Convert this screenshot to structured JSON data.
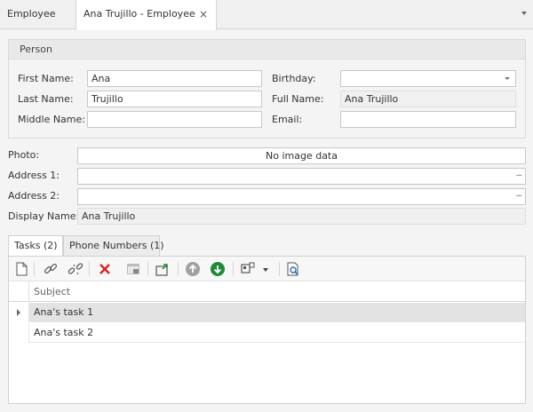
{
  "doc_tabs": {
    "first": "Employee",
    "active": "Ana Trujillo - Employee",
    "close": "×"
  },
  "person": {
    "header": "Person",
    "first_name_label": "First Name:",
    "first_name": "Ana",
    "last_name_label": "Last Name:",
    "last_name": "Trujillo",
    "middle_name_label": "Middle Name:",
    "middle_name": "",
    "birthday_label": "Birthday:",
    "birthday": "",
    "full_name_label": "Full Name:",
    "full_name": "Ana Trujillo",
    "email_label": "Email:",
    "email": ""
  },
  "details": {
    "photo_label": "Photo:",
    "photo_value": "No image data",
    "address1_label": "Address 1:",
    "address1": "",
    "address2_label": "Address 2:",
    "address2": "",
    "display_name_label": "Display Name:",
    "display_name": "Ana Trujillo",
    "ellipsis": "···"
  },
  "detail_tabs": [
    {
      "label": "Tasks (2)",
      "active": true
    },
    {
      "label": "Phone Numbers (1)",
      "active": false
    }
  ],
  "toolbar_icons": [
    "new-icon",
    "link-icon",
    "unlink-icon",
    "delete-icon",
    "edit-icon",
    "export-icon",
    "move-up-icon",
    "move-down-icon",
    "view-variants-icon",
    "dropdown-icon",
    "print-preview-icon"
  ],
  "grid": {
    "column": "Subject",
    "rows": [
      "Ana's task 1",
      "Ana's task 2"
    ]
  },
  "colors": {
    "delete": "#e02020",
    "move_up": "#a0a0a0",
    "move_down": "#1e8a3a",
    "accent": "#2e6db4"
  }
}
